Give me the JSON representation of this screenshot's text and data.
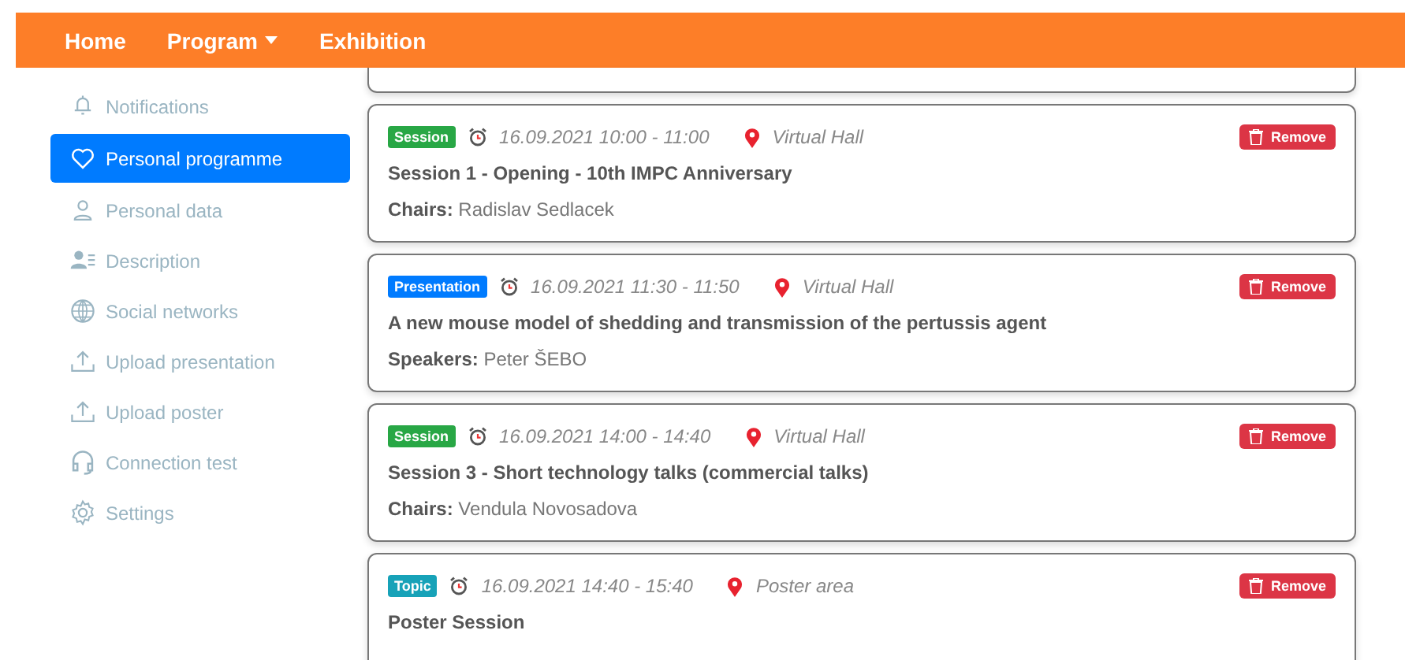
{
  "navbar": {
    "items": [
      {
        "label": "Home",
        "dropdown": false
      },
      {
        "label": "Program",
        "dropdown": true
      },
      {
        "label": "Exhibition",
        "dropdown": false
      }
    ]
  },
  "sidebar": {
    "items": [
      {
        "label": "Notifications",
        "selected": false
      },
      {
        "label": "Personal programme",
        "selected": true
      },
      {
        "label": "Personal data",
        "selected": false
      },
      {
        "label": "Description",
        "selected": false
      },
      {
        "label": "Social networks",
        "selected": false
      },
      {
        "label": "Upload presentation",
        "selected": false
      },
      {
        "label": "Upload poster",
        "selected": false
      },
      {
        "label": "Connection test",
        "selected": false
      },
      {
        "label": "Settings",
        "selected": false
      }
    ]
  },
  "entries": [
    {
      "kind": "session",
      "badge": "Session",
      "time": "16.09.2021 10:00 - 11:00",
      "location": "Virtual Hall",
      "title": "Session 1 - Opening - 10th IMPC Anniversary",
      "people": "**Chairs:** Radislav Sedlacek",
      "button": "Remove"
    },
    {
      "kind": "presentation",
      "badge": "Presentation",
      "time": "16.09.2021 11:30 - 11:50",
      "location": "Virtual Hall",
      "title": "A new mouse model of shedding and transmission of the pertussis agent",
      "people": "**Speakers:** Peter ŠEBO",
      "button": "Remove"
    },
    {
      "kind": "session",
      "badge": "Session",
      "time": "16.09.2021 14:00 - 14:40",
      "location": "Virtual Hall",
      "title": "Session 3 - Short technology talks (commercial talks)",
      "people": "**Chairs:** Vendula Novosadova",
      "button": "Remove"
    },
    {
      "kind": "topic",
      "badge": "Topic",
      "time": "16.09.2021 14:40 - 15:40",
      "location": "Poster area",
      "title": "Poster Session",
      "button": "Remove"
    }
  ]
}
